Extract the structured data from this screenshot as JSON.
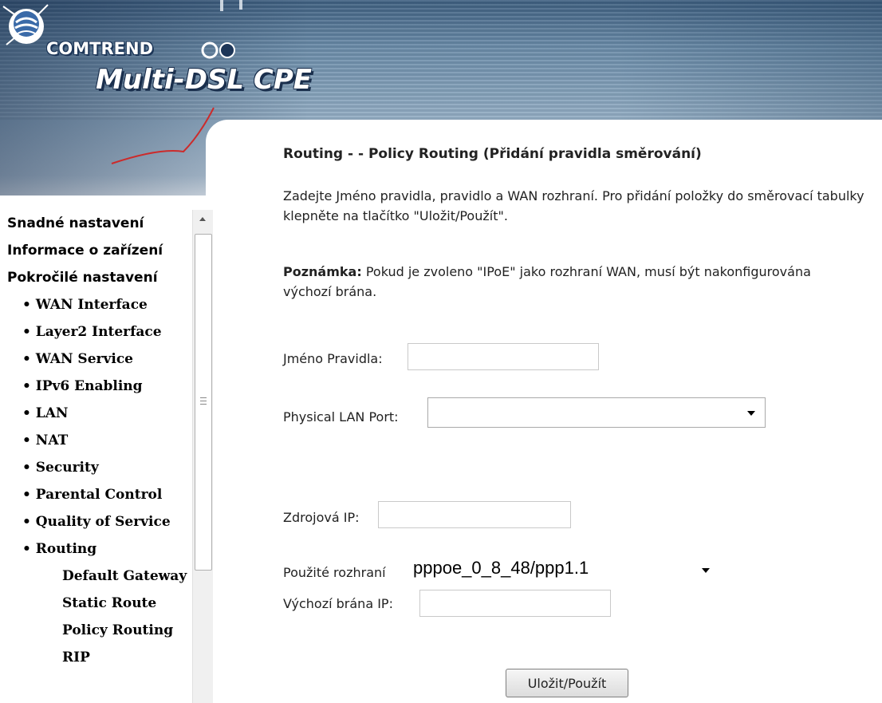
{
  "header": {
    "brand": "COMTREND",
    "product": "Multi-DSL CPE"
  },
  "sidebar": {
    "items": [
      {
        "label": "Snadné nastavení",
        "level": 1
      },
      {
        "label": "Informace o zařízení",
        "level": 1
      },
      {
        "label": "Pokročilé nastavení",
        "level": 1
      },
      {
        "label": "• WAN Interface",
        "level": 2
      },
      {
        "label": "• Layer2 Interface",
        "level": 2
      },
      {
        "label": "• WAN Service",
        "level": 2
      },
      {
        "label": "• IPv6 Enabling",
        "level": 2
      },
      {
        "label": "• LAN",
        "level": 2
      },
      {
        "label": "• NAT",
        "level": 2
      },
      {
        "label": "• Security",
        "level": 2
      },
      {
        "label": "• Parental Control",
        "level": 2
      },
      {
        "label": "• Quality of Service",
        "level": 2
      },
      {
        "label": "• Routing",
        "level": 2
      },
      {
        "label": "Default Gateway",
        "level": 3
      },
      {
        "label": "Static Route",
        "level": 3
      },
      {
        "label": "Policy Routing",
        "level": 3
      },
      {
        "label": "RIP",
        "level": 3
      }
    ]
  },
  "main": {
    "title": "Routing - - Policy Routing (Přidání pravidla směrování)",
    "description": "Zadejte Jméno pravidla, pravidlo a WAN rozhraní. Pro přidání položky do směrovací tabulky klepněte na tlačítko \"Uložit/Použít\".",
    "note_label": "Poznámka:",
    "note_text": " Pokud je zvoleno \"IPoE\" jako rozhraní WAN, musí být nakonfigurována výchozí brána.",
    "form": {
      "rule_name_label": "Jméno Pravidla:",
      "rule_name_value": "",
      "lan_port_label": "Physical LAN Port:",
      "lan_port_value": "",
      "source_ip_label": "Zdrojová IP:",
      "source_ip_value": "",
      "interface_label": "Použité rozhraní",
      "interface_value": "pppoe_0_8_48/ppp1.1",
      "gateway_label": "Výchozí brána IP:",
      "gateway_value": ""
    },
    "submit_label": "Uložit/Použít"
  }
}
